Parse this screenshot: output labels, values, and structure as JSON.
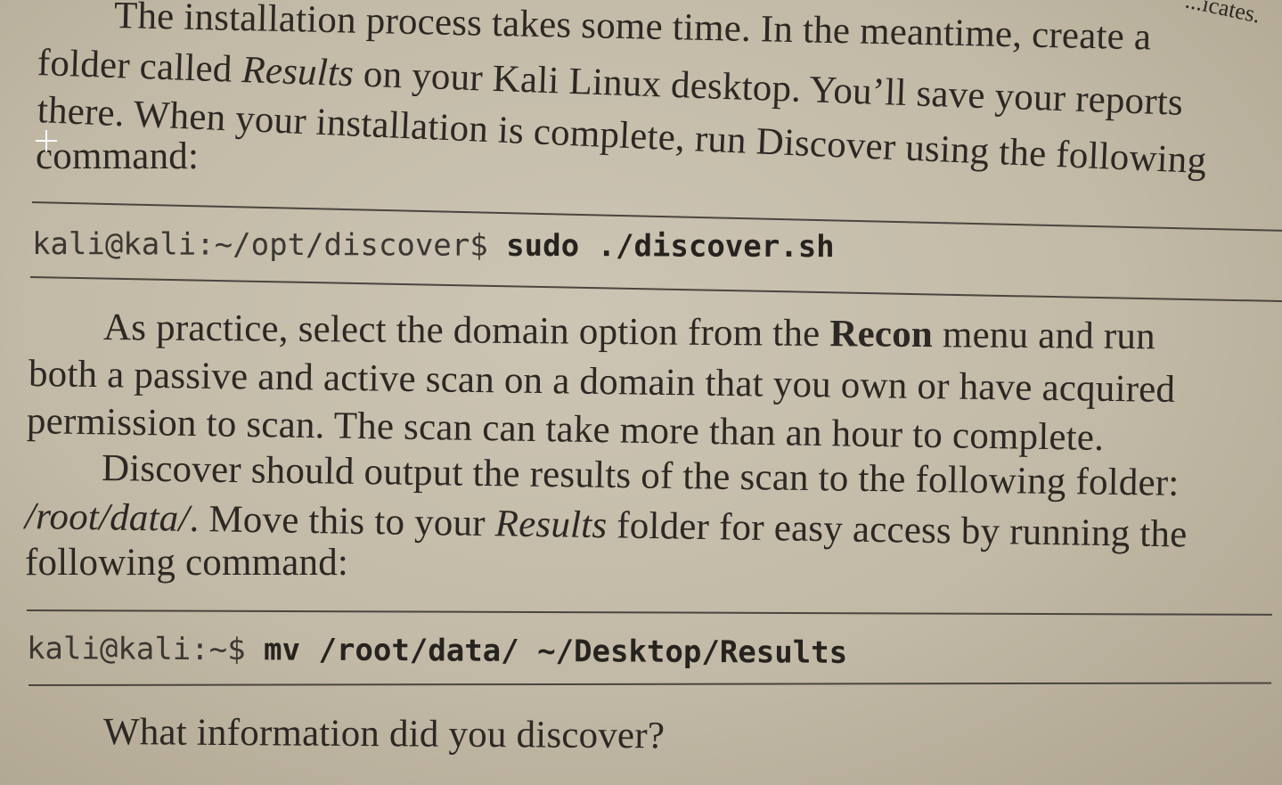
{
  "page": {
    "edge_fragment": "...icates.",
    "para1": {
      "line1": "The installation process takes some time. In the meantime, create a",
      "line2_a": "folder called ",
      "line2_em": "Results",
      "line2_b": " on your Kali Linux desktop. You’ll save your reports",
      "line3": "there. When your installation is complete, run Discover using the following",
      "line4": "command:"
    },
    "code1": {
      "prompt": "kali@kali:~/opt/discover$ ",
      "command": "sudo ./discover.sh"
    },
    "para2": {
      "line1_a": "As practice, select the domain option from the ",
      "line1_strong": "Recon",
      "line1_b": " menu and run",
      "line2": "both a passive and active scan on a domain that you own or have acquired",
      "line3": "permission to scan. The scan can take more than an hour to complete."
    },
    "para3": {
      "line1": "Discover should output the results of the scan to the following folder:",
      "line2_em1": "/root/data/",
      "line2_a": ". Move this to your ",
      "line2_em2": "Results",
      "line2_b": " folder for easy access by running the",
      "line3": "following command:"
    },
    "code2": {
      "prompt": "kali@kali:~$ ",
      "command": "mv /root/data/ ~/Desktop/Results"
    },
    "question": "What information did you discover?"
  }
}
